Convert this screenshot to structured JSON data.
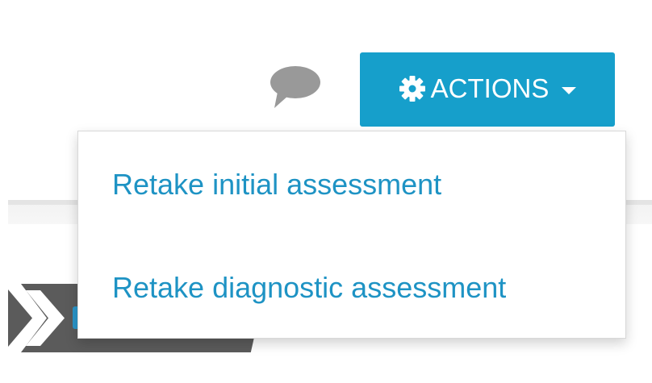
{
  "header": {
    "comment_icon": "comment-bubble-icon",
    "actions_button": {
      "label": "ACTIONS",
      "icon": "gear-icon",
      "caret": "caret-down-icon",
      "color": "#169fcb"
    }
  },
  "dropdown": {
    "items": [
      {
        "label": "Retake initial assessment"
      },
      {
        "label": "Retake diagnostic assessment"
      }
    ],
    "link_color": "#1e93c4"
  },
  "colors": {
    "comment_icon": "#999999",
    "banner": "#5b5b5b",
    "banner_accent": "#2a95c9"
  }
}
